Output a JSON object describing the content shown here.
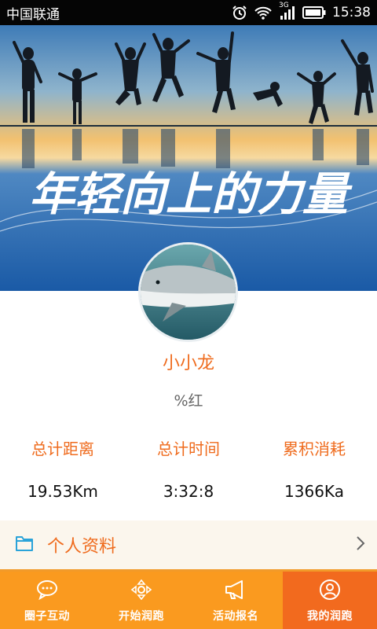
{
  "status_bar": {
    "carrier": "中国联通",
    "network": "3G",
    "time": "15:38"
  },
  "banner": {
    "slogan": "年轻向上的力量"
  },
  "profile": {
    "username": "小小龙",
    "signature": "%红"
  },
  "stats": [
    {
      "label": "总计距离",
      "value": "19.53Km"
    },
    {
      "label": "总计时间",
      "value": "3:32:8"
    },
    {
      "label": "累积消耗",
      "value": "1366Ka"
    }
  ],
  "menu": {
    "personal_info": "个人资料"
  },
  "tabs": [
    {
      "label": "圈子互动",
      "icon": "chat-bubble-icon"
    },
    {
      "label": "开始润跑",
      "icon": "direction-arrows-icon"
    },
    {
      "label": "活动报名",
      "icon": "megaphone-icon"
    },
    {
      "label": "我的润跑",
      "icon": "user-icon",
      "active": true
    }
  ],
  "colors": {
    "accent": "#ef6b1d",
    "tabbar": "#fa9a1f",
    "tab_active": "#f26a1e"
  }
}
